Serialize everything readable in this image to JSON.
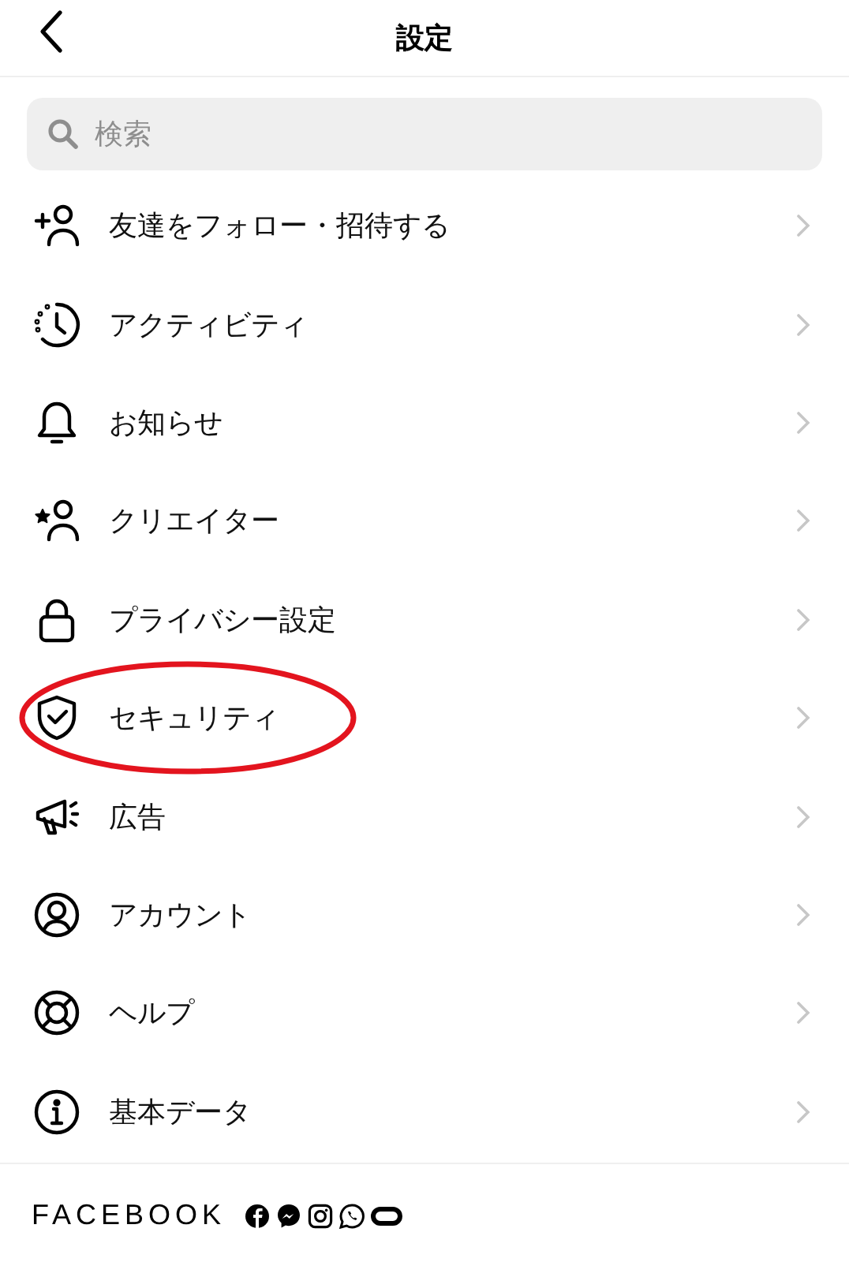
{
  "header": {
    "title": "設定"
  },
  "search": {
    "placeholder": "検索"
  },
  "items": [
    {
      "label": "友達をフォロー・招待する",
      "circled": false
    },
    {
      "label": "アクティビティ",
      "circled": false
    },
    {
      "label": "お知らせ",
      "circled": false
    },
    {
      "label": "クリエイター",
      "circled": false
    },
    {
      "label": "プライバシー設定",
      "circled": false
    },
    {
      "label": "セキュリティ",
      "circled": true
    },
    {
      "label": "広告",
      "circled": false
    },
    {
      "label": "アカウント",
      "circled": false
    },
    {
      "label": "ヘルプ",
      "circled": false
    },
    {
      "label": "基本データ",
      "circled": false
    }
  ],
  "footer": {
    "brand": "FACEBOOK"
  }
}
